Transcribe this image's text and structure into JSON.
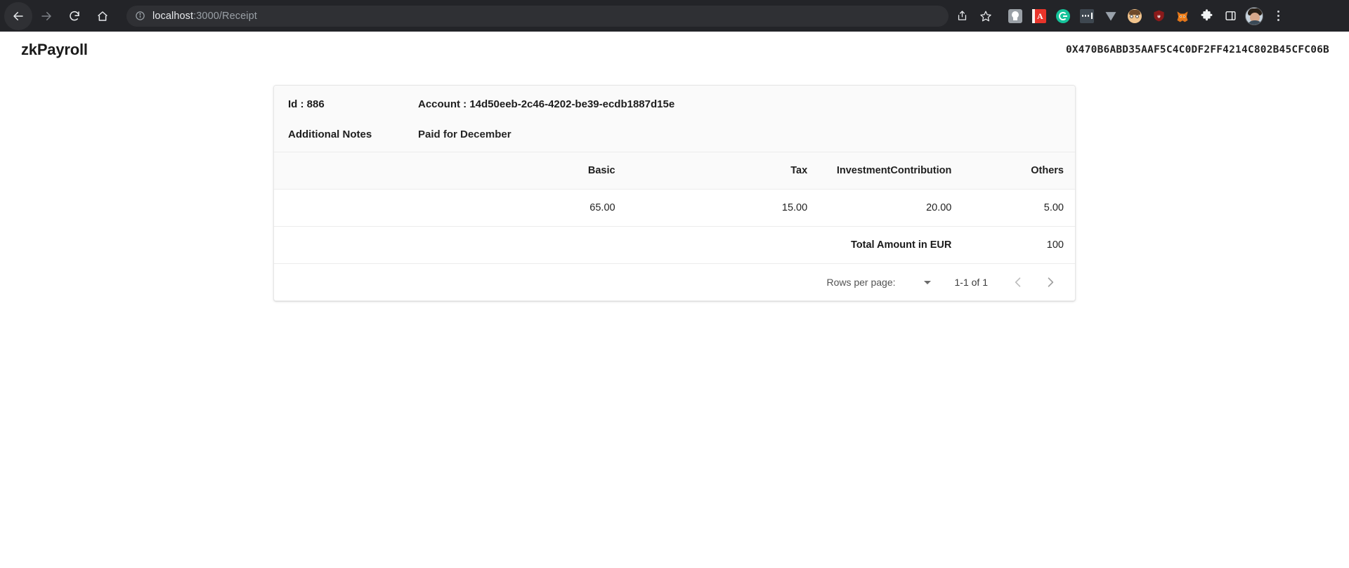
{
  "browser": {
    "nav": {
      "back_label": "Back",
      "forward_label": "Forward",
      "reload_label": "Reload",
      "home_label": "Home"
    },
    "omnibox": {
      "site_info_label": "View site information",
      "url_host": "localhost",
      "url_path": ":3000/Receipt",
      "url_full": "localhost:3000/Receipt"
    },
    "actions": {
      "share_label": "Share this page",
      "bookmark_label": "Bookmark this tab",
      "sidepanel_label": "Side panel",
      "extensions_label": "Extensions",
      "profile_label": "Profile",
      "menu_label": "Customize and control Google Chrome"
    },
    "extensions": [
      {
        "name": "lamp-extension-icon",
        "color": "#9aa0a6",
        "label": "Lamp"
      },
      {
        "name": "adobe-acrobat-extension-icon",
        "color": "#e8342a",
        "label": "Adobe Acrobat"
      },
      {
        "name": "grammarly-extension-icon",
        "color": "#15c39a",
        "label": "Grammarly"
      },
      {
        "name": "dotted-extension-icon",
        "color": "#3e4750",
        "label": "More"
      },
      {
        "name": "vimeo-extension-icon",
        "color": "#9aa2ab",
        "label": "V"
      },
      {
        "name": "honey-extension-icon",
        "color": "#f2c48d",
        "label": "Honey"
      },
      {
        "name": "ublock-extension-icon",
        "color": "#8b1a1a",
        "label": "uBlock Origin"
      },
      {
        "name": "metamask-extension-icon",
        "color": "#e2761b",
        "label": "MetaMask"
      }
    ]
  },
  "app": {
    "title": "zkPayroll",
    "wallet_address": "0X470B6ABD35AAF5C4C0DF2FF4214C802B45CFC06B"
  },
  "receipt": {
    "id_label": "Id : 886",
    "account_label": "Account : 14d50eeb-2c46-4202-be39-ecdb1887d15e",
    "notes_label": "Additional Notes",
    "notes_value": "Paid for December",
    "columns": [
      "",
      "Basic",
      "Tax",
      "InvestmentContribution",
      "Others"
    ],
    "rows": [
      {
        "spacer": "",
        "basic": "65.00",
        "tax": "15.00",
        "investment": "20.00",
        "others": "5.00"
      }
    ],
    "total_label": "Total Amount in EUR",
    "total_value": "100"
  },
  "pagination": {
    "rows_per_page_label": "Rows per page:",
    "rows_per_page_value": "",
    "range_label": "1-1 of 1",
    "prev_label": "Previous page",
    "next_label": "Next page"
  }
}
